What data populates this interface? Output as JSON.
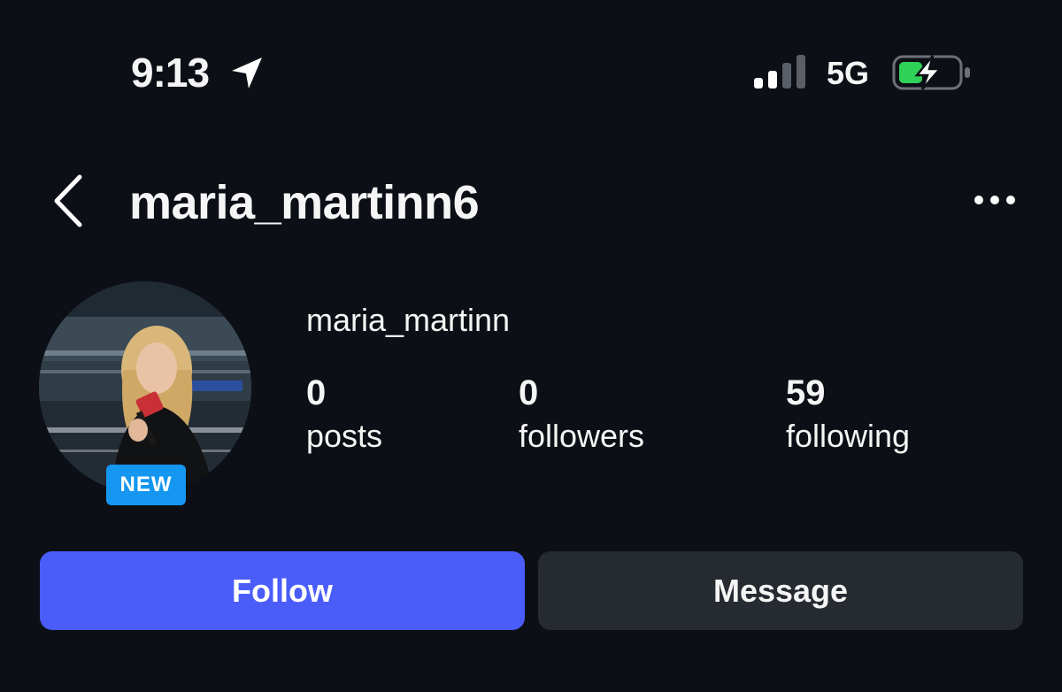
{
  "status_bar": {
    "time": "9:13",
    "network": "5G",
    "battery_charging": true,
    "icons": [
      "location-arrow-icon",
      "cellular-signal-icon",
      "battery-charging-icon"
    ],
    "colors": {
      "battery_fill": "#30d158"
    }
  },
  "header": {
    "username": "maria_martinn6",
    "back_icon": "chevron-left-icon",
    "more_icon": "ellipsis-icon"
  },
  "profile": {
    "display_name": "maria_martinn",
    "badge": "NEW",
    "stats": [
      {
        "value": "0",
        "label": "posts"
      },
      {
        "value": "0",
        "label": "followers"
      },
      {
        "value": "59",
        "label": "following"
      }
    ]
  },
  "actions": {
    "follow_label": "Follow",
    "message_label": "Message"
  },
  "colors": {
    "background": "#0c1016",
    "follow_button": "#4a5df9",
    "message_button": "#262a31",
    "badge": "#1596f0"
  }
}
